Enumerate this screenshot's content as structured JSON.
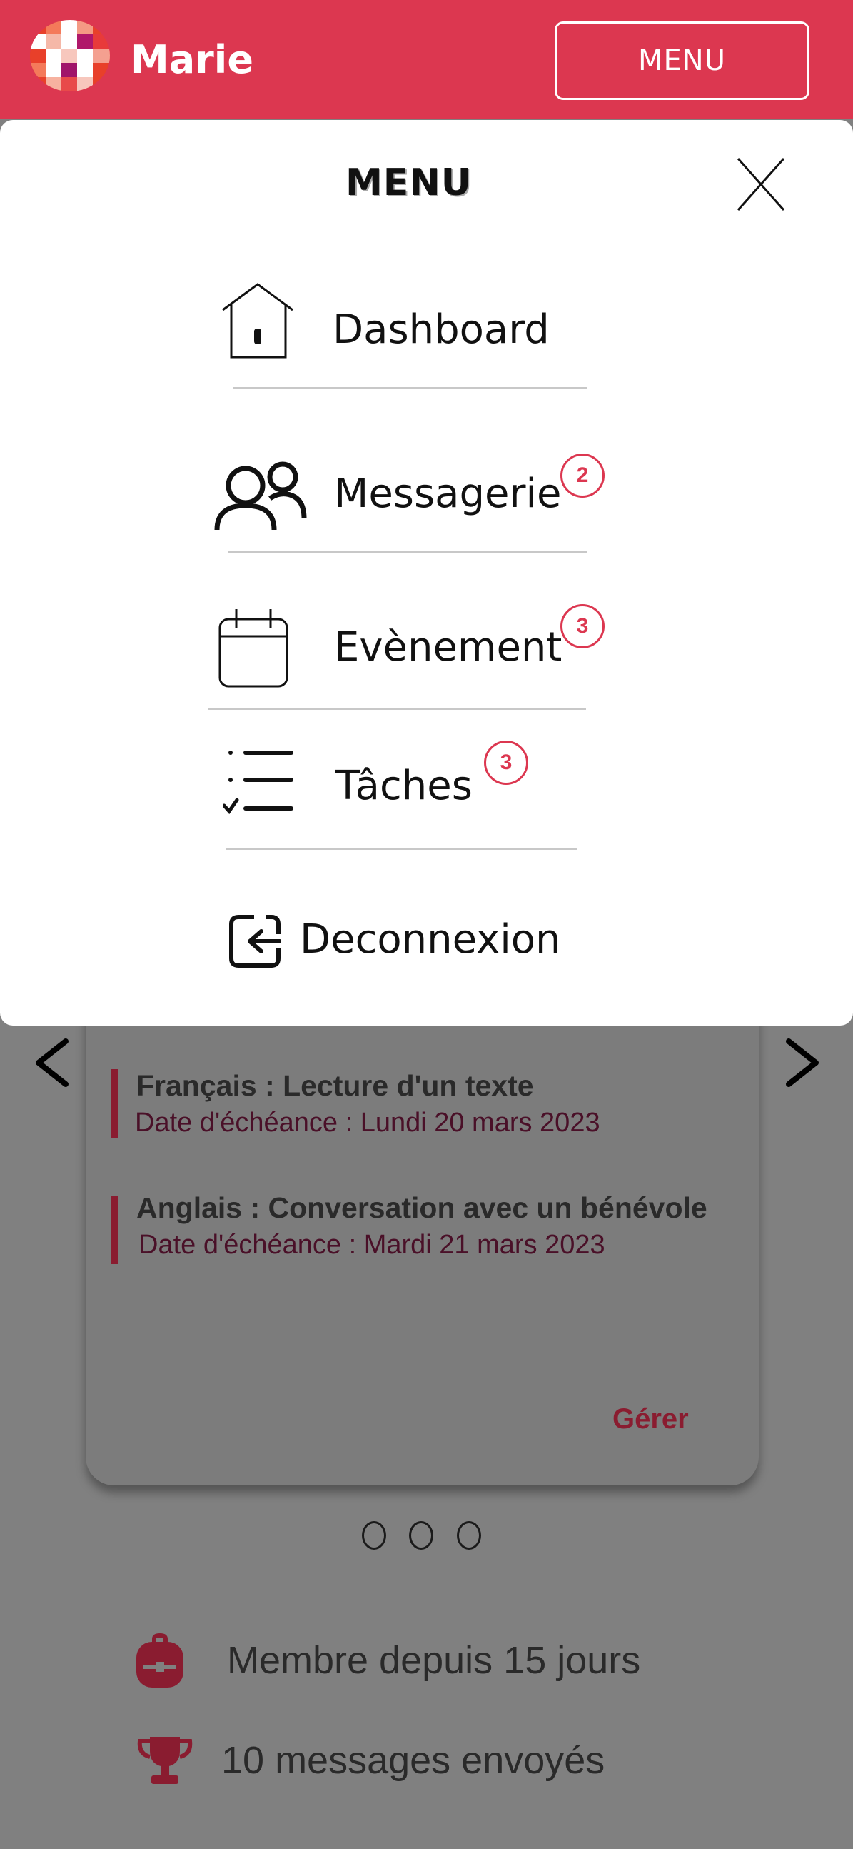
{
  "header": {
    "user_name": "Marie",
    "menu_button": "MENU"
  },
  "menu": {
    "title": "MENU",
    "items": [
      {
        "label": "Dashboard",
        "icon": "home-icon"
      },
      {
        "label": "Messagerie",
        "icon": "users-icon",
        "badge": "2"
      },
      {
        "label": "Evènement",
        "icon": "calendar-icon",
        "badge": "3"
      },
      {
        "label": "Tâches",
        "icon": "checklist-icon",
        "badge": "3"
      }
    ],
    "logout": {
      "label": "Deconnexion",
      "icon": "logout-icon"
    }
  },
  "tasks_card": {
    "tasks": [
      {
        "title": "Français : Lecture d'un texte",
        "due": "Date d'échéance : Lundi 20 mars 2023"
      },
      {
        "title": "Anglais : Conversation avec un bénévole",
        "due": "Date d'échéance : Mardi 21 mars 2023"
      }
    ],
    "manage_link": "Gérer",
    "carousel_pages": 3
  },
  "stats": [
    {
      "icon": "backpack-icon",
      "text": "Membre depuis 15 jours"
    },
    {
      "icon": "trophy-icon",
      "text": "10 messages envoyés"
    }
  ],
  "colors": {
    "brand": "#dc3750",
    "accent_dark": "#8a1c30",
    "overlay": "#808080"
  }
}
